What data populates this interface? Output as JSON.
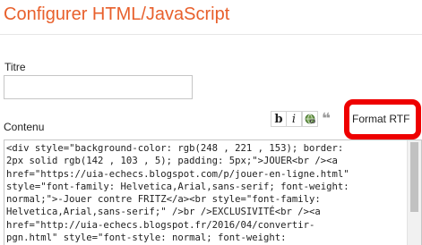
{
  "header": {
    "title": "Configurer HTML/JavaScript"
  },
  "form": {
    "title_label": "Titre",
    "title_value": "",
    "content_label": "Contenu"
  },
  "toolbar": {
    "bold_label": "b",
    "italic_label": "i",
    "link_icon": "link-globe-icon",
    "quote_label": "❝",
    "format_rtf_label": "Format RTF"
  },
  "editor": {
    "content": "<div style=\"background-color: rgb(248 , 221 , 153); border:\n2px solid rgb(142 , 103 , 5); padding: 5px;\">JOUER<br /><a\nhref=\"https://uia-echecs.blogspot.com/p/jouer-en-ligne.html\"\nstyle=\"font-family: Helvetica,Arial,sans-serif; font-weight:\nnormal;\">-Jouer contre FRITZ</a><br style=\"font-family:\nHelvetica,Arial,sans-serif;\" />br />EXCLUSIVITÉ<br /><a\nhref=\"http://uia-echecs.blogspot.fr/2016/04/convertir-\npgn.html\" style=\"font-style: normal; font-weight:"
  },
  "colors": {
    "title": "#e8602c",
    "highlight": "#ee0000"
  }
}
